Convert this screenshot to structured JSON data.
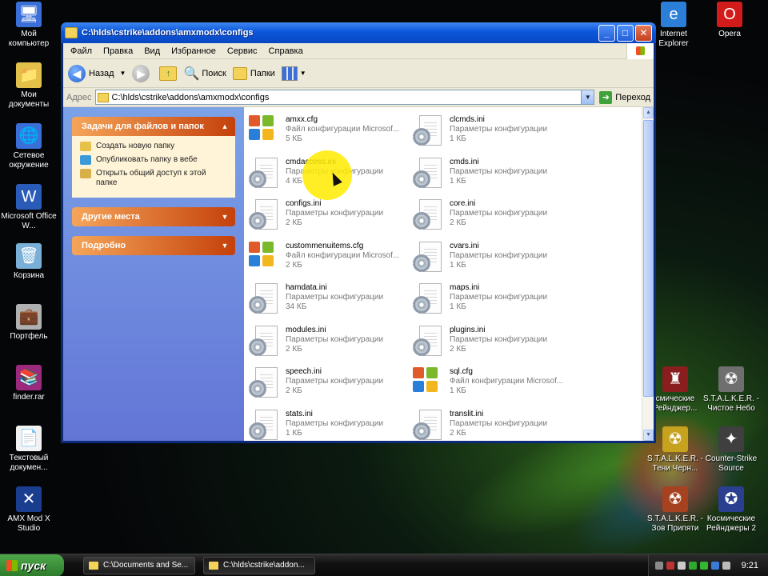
{
  "desktop": {
    "left_icons": [
      {
        "name": "computer-icon",
        "label": "Мой компьютер",
        "glyph": "🖥",
        "color": "#3a6fd8"
      },
      {
        "name": "documents-icon",
        "label": "Мои документы",
        "glyph": "📁",
        "color": "#e2c04a"
      },
      {
        "name": "network-icon",
        "label": "Сетевое окружение",
        "glyph": "🌐",
        "color": "#3a6fd8"
      },
      {
        "name": "word-icon",
        "label": "Microsoft Office W...",
        "glyph": "W",
        "color": "#2a5bb8"
      },
      {
        "name": "recycle-bin-icon",
        "label": "Корзина",
        "glyph": "🗑",
        "color": "#7ab0d8"
      },
      {
        "name": "briefcase-icon",
        "label": "Портфель",
        "glyph": "💼",
        "color": "#b0b0b0"
      },
      {
        "name": "rar-archive-icon",
        "label": "finder.rar",
        "glyph": "📚",
        "color": "#9b2a7d"
      },
      {
        "name": "text-document-icon",
        "label": "Текстовый докумен...",
        "glyph": "📄",
        "color": "#f2f2f2"
      },
      {
        "name": "amxmodx-studio-icon",
        "label": "AMX Mod X Studio",
        "glyph": "✕",
        "color": "#1b3d8f"
      }
    ],
    "right_icons": [
      {
        "name": "internet-explorer-icon",
        "label": "Internet Explorer",
        "glyph": "e",
        "color": "#2c7fd8"
      },
      {
        "name": "opera-icon",
        "label": "Opera",
        "glyph": "O",
        "color": "#d21b1b"
      },
      {
        "name": "game-icon-1",
        "label": "смические Рейнджер...",
        "glyph": "♜",
        "color": "#8a1e1e"
      },
      {
        "name": "stalker-clear-sky-icon",
        "label": "S.T.A.L.K.E.R. - Чистое Небо",
        "glyph": "☢",
        "color": "#6f6f6f"
      },
      {
        "name": "stalker-shadow-icon",
        "label": "S.T.A.L.K.E.R. - Тени Черн...",
        "glyph": "☢",
        "color": "#c7a21e"
      },
      {
        "name": "counter-strike-icon",
        "label": "Counter-Strike Source",
        "glyph": "✦",
        "color": "#3f3f3f"
      },
      {
        "name": "stalker-pripyat-icon",
        "label": "S.T.A.L.K.E.R. - Зов Припяти",
        "glyph": "☢",
        "color": "#a6421f"
      },
      {
        "name": "space-rangers-2-icon",
        "label": "Космические Рейнджеры 2",
        "glyph": "✪",
        "color": "#2a3f8f"
      }
    ]
  },
  "window": {
    "title": "C:\\hlds\\cstrike\\addons\\amxmodx\\configs",
    "controls": {
      "minimize": "_",
      "maximize": "□",
      "close": "✕"
    }
  },
  "menu": [
    "Файл",
    "Правка",
    "Вид",
    "Избранное",
    "Сервис",
    "Справка"
  ],
  "toolbar": {
    "back": "Назад",
    "search": "Поиск",
    "folders": "Папки"
  },
  "address": {
    "label": "Адрес",
    "value": "C:\\hlds\\cstrike\\addons\\amxmodx\\configs",
    "go": "Переход"
  },
  "tasks": {
    "file_tasks_title": "Задачи для файлов и папок",
    "file_tasks": [
      {
        "label": "Создать новую папку",
        "color": "#e7c24a"
      },
      {
        "label": "Опубликовать папку в вебе",
        "color": "#3a9bd8"
      },
      {
        "label": "Открыть общий доступ к этой папке",
        "color": "#d8b04a"
      }
    ],
    "other_places_title": "Другие места",
    "details_title": "Подробно"
  },
  "files": [
    {
      "name": "amxx.cfg",
      "type": "Файл конфигурации Microsof...",
      "size": "5 КБ",
      "icon": "office"
    },
    {
      "name": "clcmds.ini",
      "type": "Параметры конфигурации",
      "size": "1 КБ",
      "icon": "ini"
    },
    {
      "name": "cmdaccess.ini",
      "type": "Параметры конфигурации",
      "size": "4 КБ",
      "icon": "ini"
    },
    {
      "name": "cmds.ini",
      "type": "Параметры конфигурации",
      "size": "1 КБ",
      "icon": "ini"
    },
    {
      "name": "configs.ini",
      "type": "Параметры конфигурации",
      "size": "2 КБ",
      "icon": "ini"
    },
    {
      "name": "core.ini",
      "type": "Параметры конфигурации",
      "size": "2 КБ",
      "icon": "ini"
    },
    {
      "name": "custommenuitems.cfg",
      "type": "Файл конфигурации Microsof...",
      "size": "2 КБ",
      "icon": "office"
    },
    {
      "name": "cvars.ini",
      "type": "Параметры конфигурации",
      "size": "1 КБ",
      "icon": "ini"
    },
    {
      "name": "hamdata.ini",
      "type": "Параметры конфигурации",
      "size": "34 КБ",
      "icon": "ini"
    },
    {
      "name": "maps.ini",
      "type": "Параметры конфигурации",
      "size": "1 КБ",
      "icon": "ini"
    },
    {
      "name": "modules.ini",
      "type": "Параметры конфигурации",
      "size": "2 КБ",
      "icon": "ini"
    },
    {
      "name": "plugins.ini",
      "type": "Параметры конфигурации",
      "size": "2 КБ",
      "icon": "ini"
    },
    {
      "name": "speech.ini",
      "type": "Параметры конфигурации",
      "size": "2 КБ",
      "icon": "ini"
    },
    {
      "name": "sql.cfg",
      "type": "Файл конфигурации Microsof...",
      "size": "1 КБ",
      "icon": "office"
    },
    {
      "name": "stats.ini",
      "type": "Параметры конфигурации",
      "size": "1 КБ",
      "icon": "ini"
    },
    {
      "name": "translit.ini",
      "type": "Параметры конфигурации",
      "size": "2 КБ",
      "icon": "ini"
    }
  ],
  "taskbar": {
    "start": "пуск",
    "tasks": [
      {
        "label": "C:\\Documents and Se...",
        "active": false
      },
      {
        "label": "C:\\hlds\\cstrike\\addon...",
        "active": true
      }
    ],
    "tray_colors": [
      "#8a8a8a",
      "#b33",
      "#c9c9c9",
      "#2fa82f",
      "#34b534",
      "#3a7bd8",
      "#bbbbbb"
    ],
    "clock": "9:21"
  }
}
